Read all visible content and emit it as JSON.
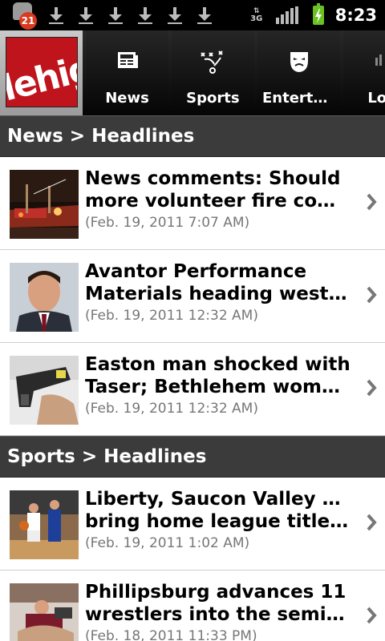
{
  "status_bar": {
    "notification_count": "21",
    "network": "3G",
    "time": "8:23",
    "icons": [
      "notification-icon",
      "download-icon",
      "download-icon",
      "download-icon",
      "download-icon",
      "download-icon",
      "download-icon",
      "network-3g-icon",
      "signal-icon",
      "battery-charging-icon"
    ]
  },
  "tabs": [
    {
      "label": "",
      "icon": "lehigh-logo",
      "logo_text": "lehigh"
    },
    {
      "label": "News",
      "icon": "newspaper-icon"
    },
    {
      "label": "Sports",
      "icon": "playbook-icon"
    },
    {
      "label": "Entertai…",
      "icon": "theater-masks-icon"
    },
    {
      "label": "Lo",
      "icon": "local-icon"
    }
  ],
  "sections": [
    {
      "title": "News > Headlines",
      "items": [
        {
          "headline_line1": "News comments: Should",
          "headline_line2": "more volunteer fire compa…",
          "date": "(Feb. 19, 2011 7:07 AM)",
          "thumb": "fire-scene-photo"
        },
        {
          "headline_line1": "Avantor Performance",
          "headline_line2": "Materials heading west to …",
          "date": "(Feb. 19, 2011 12:32 AM)",
          "thumb": "man-portrait-photo"
        },
        {
          "headline_line1": "Easton man shocked with",
          "headline_line2": "Taser; Bethlehem woman s…",
          "date": "(Feb. 19, 2011 12:32 AM)",
          "thumb": "taser-photo"
        }
      ]
    },
    {
      "title": "Sports > Headlines",
      "items": [
        {
          "headline_line1": "Liberty, Saucon Valley boys",
          "headline_line2": "bring home league titles - …",
          "date": "(Feb. 19, 2011 1:02 AM)",
          "thumb": "basketball-photo"
        },
        {
          "headline_line1": "Phillipsburg advances 11",
          "headline_line2": "wrestlers into the semifina…",
          "date": "(Feb. 18, 2011 11:33 PM)",
          "thumb": "wrestling-photo"
        }
      ]
    }
  ],
  "colors": {
    "brand_red": "#c0141c",
    "section_header": "#3b3b3b",
    "date_text": "#777777",
    "battery": "#6bc121"
  }
}
